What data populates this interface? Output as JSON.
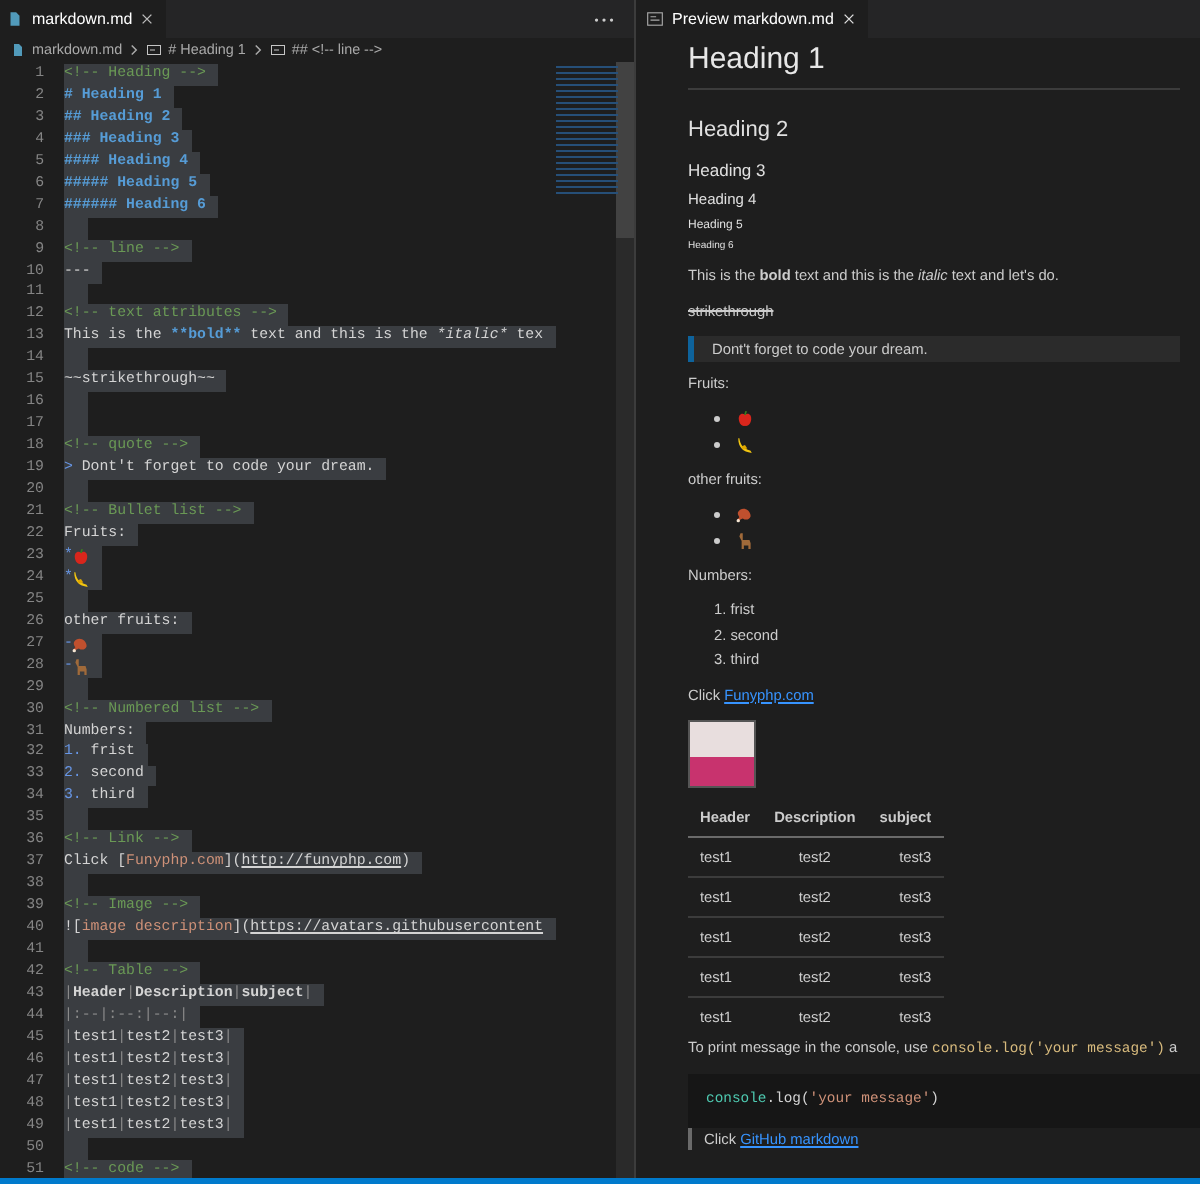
{
  "editor": {
    "tabs": [
      {
        "label": "markdown.md",
        "selected": true
      }
    ],
    "breadcrumbs": [
      {
        "text": "markdown.md"
      },
      {
        "text": "# Heading 1"
      },
      {
        "text": "## <!-- line -->"
      }
    ],
    "lines": [
      {
        "number": "1",
        "segments": [
          {
            "kind": "comment",
            "text": "<!-- Heading -->"
          }
        ]
      },
      {
        "number": "2",
        "segments": [
          {
            "kind": "heading",
            "text": "# Heading 1"
          }
        ]
      },
      {
        "number": "3",
        "segments": [
          {
            "kind": "heading",
            "text": "## Heading 2"
          }
        ]
      },
      {
        "number": "4",
        "segments": [
          {
            "kind": "heading",
            "text": "### Heading 3"
          }
        ]
      },
      {
        "number": "5",
        "segments": [
          {
            "kind": "heading",
            "text": "#### Heading 4"
          }
        ]
      },
      {
        "number": "6",
        "segments": [
          {
            "kind": "heading",
            "text": "##### Heading 5"
          }
        ]
      },
      {
        "number": "7",
        "segments": [
          {
            "kind": "heading",
            "text": "###### Heading 6"
          }
        ]
      },
      {
        "number": "8"
      },
      {
        "number": "9",
        "segments": [
          {
            "kind": "comment",
            "text": "<!-- line -->"
          }
        ]
      },
      {
        "number": "10",
        "segments": [
          {
            "kind": "plain",
            "text": "---"
          }
        ]
      },
      {
        "number": "11"
      },
      {
        "number": "12",
        "segments": [
          {
            "kind": "comment",
            "text": "<!-- text attributes -->"
          }
        ]
      },
      {
        "number": "13",
        "segments": [
          {
            "kind": "plain",
            "text": "This is the "
          },
          {
            "kind": "bold",
            "text": "**bold**"
          },
          {
            "kind": "plain",
            "text": " text and this is the "
          },
          {
            "kind": "italic",
            "text": "*italic*"
          },
          {
            "kind": "plain",
            "text": " tex"
          }
        ]
      },
      {
        "number": "14"
      },
      {
        "number": "15",
        "segments": [
          {
            "kind": "plain",
            "text": "~~strikethrough~~"
          }
        ]
      },
      {
        "number": "16"
      },
      {
        "number": "17"
      },
      {
        "number": "18",
        "segments": [
          {
            "kind": "comment",
            "text": "<!-- quote -->"
          }
        ]
      },
      {
        "number": "19",
        "segments": [
          {
            "kind": "marker",
            "text": ">"
          },
          {
            "kind": "plain",
            "text": " Dont't forget to code your dream."
          }
        ]
      },
      {
        "number": "20"
      },
      {
        "number": "21",
        "segments": [
          {
            "kind": "comment",
            "text": "<!-- Bullet list -->"
          }
        ]
      },
      {
        "number": "22",
        "segments": [
          {
            "kind": "plain",
            "text": "Fruits:"
          }
        ]
      },
      {
        "number": "23",
        "segments": [
          {
            "kind": "marker",
            "text": "*"
          },
          {
            "kind": "apple"
          }
        ]
      },
      {
        "number": "24",
        "segments": [
          {
            "kind": "marker",
            "text": "*"
          },
          {
            "kind": "banana"
          }
        ]
      },
      {
        "number": "25"
      },
      {
        "number": "26",
        "segments": [
          {
            "kind": "plain",
            "text": "other fruits:"
          }
        ]
      },
      {
        "number": "27",
        "segments": [
          {
            "kind": "marker",
            "text": "-"
          },
          {
            "kind": "meat"
          }
        ]
      },
      {
        "number": "28",
        "segments": [
          {
            "kind": "marker",
            "text": "-"
          },
          {
            "kind": "animal"
          }
        ]
      },
      {
        "number": "29"
      },
      {
        "number": "30",
        "segments": [
          {
            "kind": "comment",
            "text": "<!-- Numbered list -->"
          }
        ]
      },
      {
        "number": "31",
        "segments": [
          {
            "kind": "plain",
            "text": "Numbers:"
          }
        ]
      },
      {
        "number": "32",
        "segments": [
          {
            "kind": "marker",
            "text": "1."
          },
          {
            "kind": "plain",
            "text": " frist"
          }
        ]
      },
      {
        "number": "33",
        "segments": [
          {
            "kind": "marker",
            "text": "2."
          },
          {
            "kind": "plain",
            "text": " second"
          }
        ]
      },
      {
        "number": "34",
        "segments": [
          {
            "kind": "marker",
            "text": "3."
          },
          {
            "kind": "plain",
            "text": " third"
          }
        ]
      },
      {
        "number": "35"
      },
      {
        "number": "36",
        "segments": [
          {
            "kind": "comment",
            "text": "<!-- Link -->"
          }
        ]
      },
      {
        "number": "37",
        "segments": [
          {
            "kind": "plain",
            "text": "Click ["
          },
          {
            "kind": "linktext",
            "text": "Funyphp.com"
          },
          {
            "kind": "plain",
            "text": "]("
          },
          {
            "kind": "url",
            "text": "http://funyphp.com"
          },
          {
            "kind": "plain",
            "text": ")"
          }
        ]
      },
      {
        "number": "38"
      },
      {
        "number": "39",
        "segments": [
          {
            "kind": "comment",
            "text": "<!-- Image -->"
          }
        ]
      },
      {
        "number": "40",
        "segments": [
          {
            "kind": "plain",
            "text": "!["
          },
          {
            "kind": "linktext",
            "text": "image description"
          },
          {
            "kind": "plain",
            "text": "]("
          },
          {
            "kind": "url",
            "text": "https://avatars.githubusercontent"
          }
        ]
      },
      {
        "number": "41"
      },
      {
        "number": "42",
        "segments": [
          {
            "kind": "comment",
            "text": "<!-- Table -->"
          }
        ]
      },
      {
        "number": "43",
        "segments": [
          {
            "kind": "pipe",
            "text": "|"
          },
          {
            "kind": "tablehead",
            "text": "Header"
          },
          {
            "kind": "pipe",
            "text": "|"
          },
          {
            "kind": "tablehead",
            "text": "Description"
          },
          {
            "kind": "pipe",
            "text": "|"
          },
          {
            "kind": "tablehead",
            "text": "subject"
          },
          {
            "kind": "pipe",
            "text": "|"
          }
        ]
      },
      {
        "number": "44",
        "segments": [
          {
            "kind": "pipe",
            "text": "|:--|:--:|--:|"
          }
        ]
      },
      {
        "number": "45",
        "segments": [
          {
            "kind": "pipe",
            "text": "|"
          },
          {
            "kind": "plain",
            "text": "test1"
          },
          {
            "kind": "pipe",
            "text": "|"
          },
          {
            "kind": "plain",
            "text": "test2"
          },
          {
            "kind": "pipe",
            "text": "|"
          },
          {
            "kind": "plain",
            "text": "test3"
          },
          {
            "kind": "pipe",
            "text": "|"
          }
        ]
      },
      {
        "number": "46",
        "segments": [
          {
            "kind": "pipe",
            "text": "|"
          },
          {
            "kind": "plain",
            "text": "test1"
          },
          {
            "kind": "pipe",
            "text": "|"
          },
          {
            "kind": "plain",
            "text": "test2"
          },
          {
            "kind": "pipe",
            "text": "|"
          },
          {
            "kind": "plain",
            "text": "test3"
          },
          {
            "kind": "pipe",
            "text": "|"
          }
        ]
      },
      {
        "number": "47",
        "segments": [
          {
            "kind": "pipe",
            "text": "|"
          },
          {
            "kind": "plain",
            "text": "test1"
          },
          {
            "kind": "pipe",
            "text": "|"
          },
          {
            "kind": "plain",
            "text": "test2"
          },
          {
            "kind": "pipe",
            "text": "|"
          },
          {
            "kind": "plain",
            "text": "test3"
          },
          {
            "kind": "pipe",
            "text": "|"
          }
        ]
      },
      {
        "number": "48",
        "segments": [
          {
            "kind": "pipe",
            "text": "|"
          },
          {
            "kind": "plain",
            "text": "test1"
          },
          {
            "kind": "pipe",
            "text": "|"
          },
          {
            "kind": "plain",
            "text": "test2"
          },
          {
            "kind": "pipe",
            "text": "|"
          },
          {
            "kind": "plain",
            "text": "test3"
          },
          {
            "kind": "pipe",
            "text": "|"
          }
        ]
      },
      {
        "number": "49",
        "segments": [
          {
            "kind": "pipe",
            "text": "|"
          },
          {
            "kind": "plain",
            "text": "test1"
          },
          {
            "kind": "pipe",
            "text": "|"
          },
          {
            "kind": "plain",
            "text": "test2"
          },
          {
            "kind": "pipe",
            "text": "|"
          },
          {
            "kind": "plain",
            "text": "test3"
          },
          {
            "kind": "pipe",
            "text": "|"
          }
        ]
      },
      {
        "number": "50"
      },
      {
        "number": "51",
        "segments": [
          {
            "kind": "comment",
            "text": "<!-- code -->"
          }
        ]
      }
    ]
  },
  "preview": {
    "tabs": [
      {
        "label": "Preview markdown.md",
        "selected": true
      }
    ],
    "blocks": [
      {
        "kind": "h1",
        "text": "Heading 1"
      },
      {
        "kind": "h2",
        "text": "Heading 2"
      },
      {
        "kind": "h3",
        "text": "Heading 3"
      },
      {
        "kind": "h4",
        "text": "Heading 4"
      },
      {
        "kind": "h5",
        "text": "Heading 5"
      },
      {
        "kind": "h6",
        "text": "Heading 6"
      },
      {
        "kind": "paragraph",
        "text": "This is the **bold** text and this is the *italic* text and let's do."
      },
      {
        "kind": "strike",
        "text": "strikethrough"
      },
      {
        "kind": "quote",
        "text": "Dont't forget to code your dream."
      },
      {
        "kind": "paragraph",
        "text": "Fruits:"
      },
      {
        "kind": "bullets",
        "items": [
          {
            "kind": "apple"
          },
          {
            "kind": "banana"
          }
        ]
      },
      {
        "kind": "paragraph",
        "text": "other fruits:"
      },
      {
        "kind": "bullets",
        "items": [
          {
            "kind": "meat"
          },
          {
            "kind": "animal"
          }
        ]
      },
      {
        "kind": "paragraph",
        "text": "Numbers:"
      },
      {
        "kind": "numbered",
        "items": [
          {
            "marker": "1.",
            "text": "frist"
          },
          {
            "marker": "2.",
            "text": "second"
          },
          {
            "marker": "3.",
            "text": "third"
          }
        ]
      },
      {
        "kind": "linkline",
        "text": "Click ",
        "link": "Funyphp.com"
      },
      {
        "kind": "image"
      },
      {
        "kind": "table",
        "columns": [
          {
            "label": "Header",
            "kind": "left"
          },
          {
            "label": "Description",
            "kind": "center"
          },
          {
            "label": "subject",
            "kind": "right"
          }
        ],
        "rows": [
          [
            "test1",
            "test2",
            "test3"
          ],
          [
            "test1",
            "test2",
            "test3"
          ],
          [
            "test1",
            "test2",
            "test3"
          ],
          [
            "test1",
            "test2",
            "test3"
          ],
          [
            "test1",
            "test2",
            "test3"
          ]
        ]
      },
      {
        "kind": "codeline",
        "text": "To print message in the console, use ",
        "code": "console.log('your message')",
        "after": " a"
      },
      {
        "kind": "codeblock",
        "tokens": [
          {
            "kind": "object",
            "text": "console"
          },
          {
            "kind": "plain",
            "text": ".log("
          },
          {
            "kind": "string",
            "text": "'your message'"
          },
          {
            "kind": "plain",
            "text": ")"
          }
        ]
      },
      {
        "kind": "quotelink",
        "text": "Click ",
        "link": "GitHub markdown"
      }
    ]
  }
}
